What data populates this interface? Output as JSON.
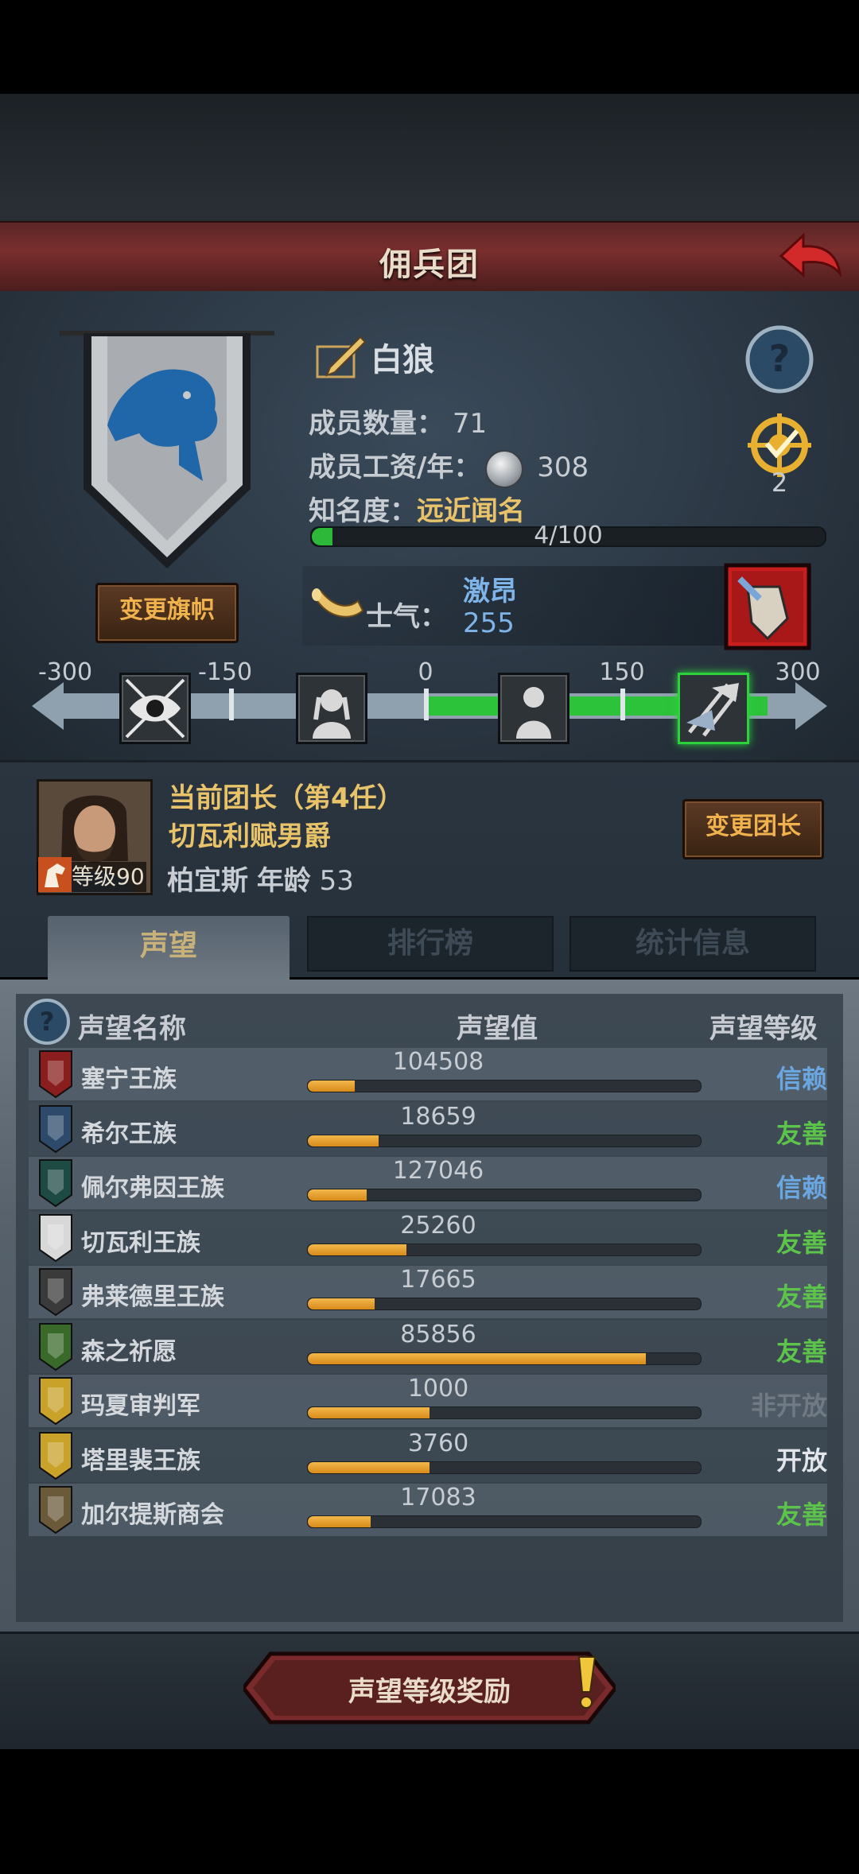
{
  "header": {
    "title": "佣兵团"
  },
  "company": {
    "name": "白狼",
    "change_flag_label": "变更旗帜",
    "members_label": "成员数量：",
    "members_value": "71",
    "salary_label": "成员工资/年：",
    "salary_value": "308",
    "fame_label": "知名度：",
    "fame_value": "远近闻名",
    "fame_progress_text": "4/100",
    "fame_progress": 0.04,
    "mission_count": "2",
    "morale_label": "士气：",
    "morale_status": "激昂",
    "morale_value": "255"
  },
  "morale_scale": {
    "ticks": [
      "-300",
      "-150",
      "0",
      "150",
      "300"
    ],
    "current": 255
  },
  "leader": {
    "line1": "当前团长（第4任）",
    "line2": "切瓦利赋男爵",
    "name": "柏宜斯",
    "age_label": "年龄",
    "age": "53",
    "level_text": "等级90",
    "change_label": "变更团长"
  },
  "tabs": [
    "声望",
    "排行榜",
    "统计信息"
  ],
  "table": {
    "col_name": "声望名称",
    "col_value": "声望值",
    "col_level": "声望等级",
    "rows": [
      {
        "name": "塞宁王族",
        "value": "104508",
        "level": "信赖",
        "fill": 0.12,
        "level_color": "#6aa6e0",
        "icon_color": "#8a1e1e"
      },
      {
        "name": "希尔王族",
        "value": "18659",
        "level": "友善",
        "fill": 0.18,
        "level_color": "#5cc44a",
        "icon_color": "#2d4a6a"
      },
      {
        "name": "佩尔弗因王族",
        "value": "127046",
        "level": "信赖",
        "fill": 0.15,
        "level_color": "#6aa6e0",
        "icon_color": "#1e4a44"
      },
      {
        "name": "切瓦利王族",
        "value": "25260",
        "level": "友善",
        "fill": 0.25,
        "level_color": "#5cc44a",
        "icon_color": "#d8d8d8"
      },
      {
        "name": "弗莱德里王族",
        "value": "17665",
        "level": "友善",
        "fill": 0.17,
        "level_color": "#5cc44a",
        "icon_color": "#3a3a3a"
      },
      {
        "name": "森之祈愿",
        "value": "85856",
        "level": "友善",
        "fill": 0.86,
        "level_color": "#5cc44a",
        "icon_color": "#3a6a2a"
      },
      {
        "name": "玛夏审判军",
        "value": "1000",
        "level": "非开放",
        "fill": 0.31,
        "level_color": "#6f7a84",
        "icon_color": "#c9a22a"
      },
      {
        "name": "塔里裴王族",
        "value": "3760",
        "level": "开放",
        "fill": 0.31,
        "level_color": "#e2e6ea",
        "icon_color": "#c9a22a"
      },
      {
        "name": "加尔提斯商会",
        "value": "17083",
        "level": "友善",
        "fill": 0.16,
        "level_color": "#5cc44a",
        "icon_color": "#6a5a3a"
      }
    ]
  },
  "reward_button": {
    "label": "声望等级奖励"
  }
}
